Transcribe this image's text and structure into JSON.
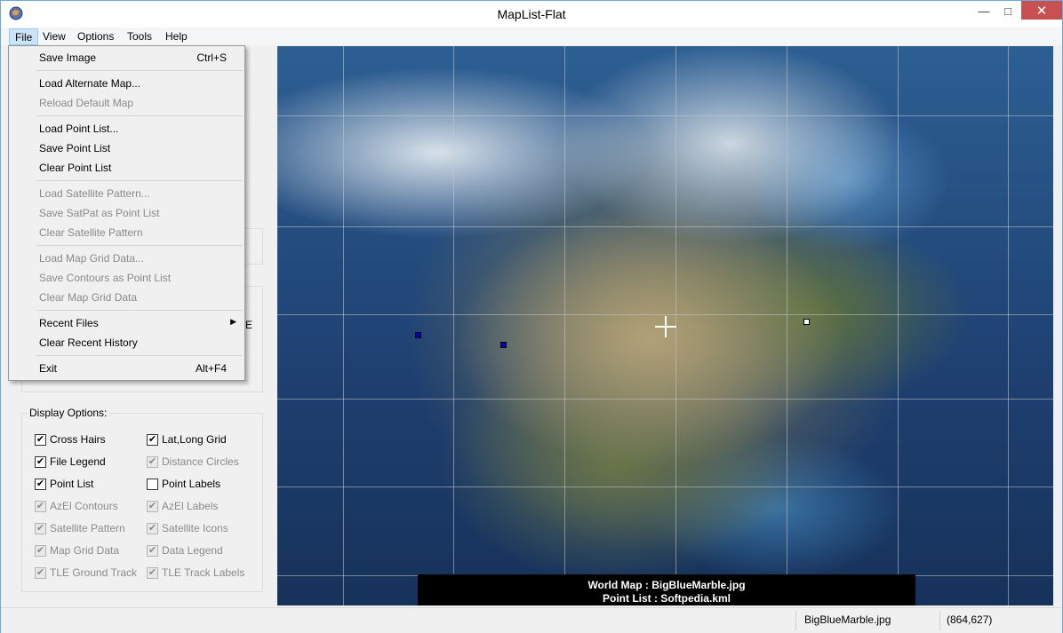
{
  "window": {
    "title": "MapList-Flat"
  },
  "controls": {
    "minimize": "—",
    "maximize": "□",
    "close": "✕"
  },
  "menubar": {
    "file": "File",
    "view": "View",
    "options": "Options",
    "tools": "Tools",
    "help": "Help"
  },
  "file_menu": {
    "save_image": "Save Image",
    "save_image_shortcut": "Ctrl+S",
    "load_alternate_map": "Load Alternate Map...",
    "reload_default_map": "Reload Default Map",
    "load_point_list": "Load Point List...",
    "save_point_list": "Save Point List",
    "clear_point_list": "Clear Point List",
    "load_satellite_pattern": "Load Satellite Pattern...",
    "save_satpat": "Save SatPat as Point List",
    "clear_satellite_pattern": "Clear Satellite Pattern",
    "load_map_grid": "Load Map Grid Data...",
    "save_contours": "Save Contours as Point List",
    "clear_map_grid": "Clear Map Grid Data",
    "recent_files": "Recent Files",
    "clear_recent_history": "Clear Recent History",
    "exit": "Exit",
    "exit_shortcut": "Alt+F4"
  },
  "left_panel": {
    "stray_char": "E"
  },
  "display_options": {
    "title": "Display Options:",
    "cross_hairs": "Cross Hairs",
    "lat_long_grid": "Lat,Long Grid",
    "file_legend": "File Legend",
    "distance_circles": "Distance Circles",
    "point_list": "Point List",
    "point_labels": "Point Labels",
    "azel_contours": "AzEl Contours",
    "azel_labels": "AzEl Labels",
    "satellite_pattern": "Satellite Pattern",
    "satellite_icons": "Satellite Icons",
    "map_grid_data": "Map Grid Data",
    "data_legend": "Data Legend",
    "tle_ground_track": "TLE Ground Track",
    "tle_track_labels": "TLE Track Labels",
    "check": "✔"
  },
  "map_legend": {
    "line1": "World Map : BigBlueMarble.jpg",
    "line2": "Point List : Softpedia.kml"
  },
  "statusbar": {
    "file": "BigBlueMarble.jpg",
    "coords": "(864,627)"
  }
}
